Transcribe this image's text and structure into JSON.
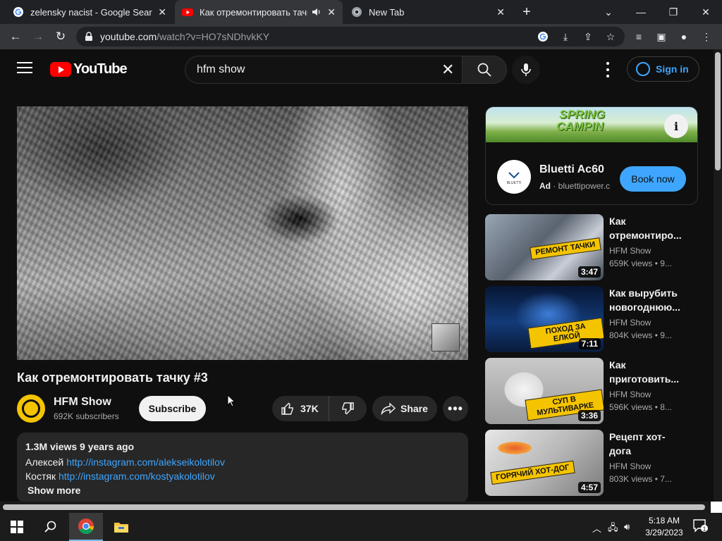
{
  "browser": {
    "tabs": [
      {
        "title": "zelensky nacist - Google Search",
        "icon": "google-icon"
      },
      {
        "title": "Как отремонтировать тачку",
        "icon": "youtube-icon",
        "audio": true
      },
      {
        "title": "New Tab",
        "icon": "chrome-icon"
      }
    ],
    "new_tab": "+",
    "url_host": "youtube.com",
    "url_path": "/watch?v=HO7sNDhvkKY"
  },
  "masthead": {
    "logo_text": "YouTube",
    "search_value": "hfm show",
    "signin_label": "Sign in"
  },
  "video": {
    "title": "Как отремонтировать тачку #3",
    "channel": "HFM Show",
    "subscribers": "692K subscribers",
    "subscribe_label": "Subscribe",
    "likes": "37K",
    "share_label": "Share",
    "description": {
      "meta": "1.3M views  9 years ago",
      "lines": [
        {
          "name": "Алексей",
          "link": "http://instagram.com/alekseikolotilov"
        },
        {
          "name": "Костяк",
          "link": "http://instagram.com/kostyakolotilov"
        }
      ],
      "show_more": "Show more"
    }
  },
  "ad": {
    "banner_text_1": "SPRING",
    "banner_text_2": "CAMPIN",
    "logo_text": "BLUETTI",
    "title": "Bluetti Ac60",
    "ad_label": "Ad",
    "domain": "bluettipower.c",
    "cta": "Book now"
  },
  "recommendations": [
    {
      "title": "Как отремонтиро...",
      "channel": "HFM Show",
      "views": "659K views  •  9...",
      "duration": "3:47",
      "caption": "РЕМОНТ ТАЧКИ"
    },
    {
      "title": "Как вырубить новогоднюю...",
      "channel": "HFM Show",
      "views": "804K views  •  9...",
      "duration": "7:11",
      "caption": "ПОХОД ЗА ЕЛКОЙ"
    },
    {
      "title": "Как приготовить...",
      "channel": "HFM Show",
      "views": "596K views  •  8...",
      "duration": "3:36",
      "caption": "СУП В МУЛЬТИВАРКЕ"
    },
    {
      "title": "Рецепт хот-дога",
      "channel": "HFM Show",
      "views": "803K views  •  7...",
      "duration": "4:57",
      "caption": "ГОРЯЧИЙ ХОТ-ДОГ"
    }
  ],
  "taskbar": {
    "time": "5:18 AM",
    "date": "3/29/2023",
    "notification_count": "1"
  },
  "colors": {
    "youtube_red": "#ff0000",
    "link_blue": "#3ea6ff",
    "background": "#0f0f0f"
  }
}
